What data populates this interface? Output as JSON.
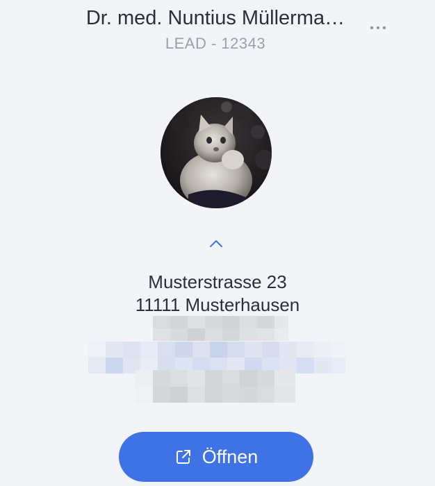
{
  "header": {
    "title": "Dr. med. Nuntius Müllerma…",
    "subtitle": "LEAD - 12343",
    "more_icon": "more-horizontal-icon"
  },
  "profile": {
    "avatar_icon": "avatar-photo"
  },
  "collapse": {
    "icon": "chevron-up-icon"
  },
  "address": {
    "street": "Musterstrasse 23",
    "city": "11111 Musterhausen"
  },
  "actions": {
    "open_label": "Öffnen",
    "open_icon": "external-link-icon"
  },
  "colors": {
    "background": "#f2f4f7",
    "accent": "#3f73e5",
    "text": "#2a2f3a",
    "muted": "#9aa0aa"
  }
}
